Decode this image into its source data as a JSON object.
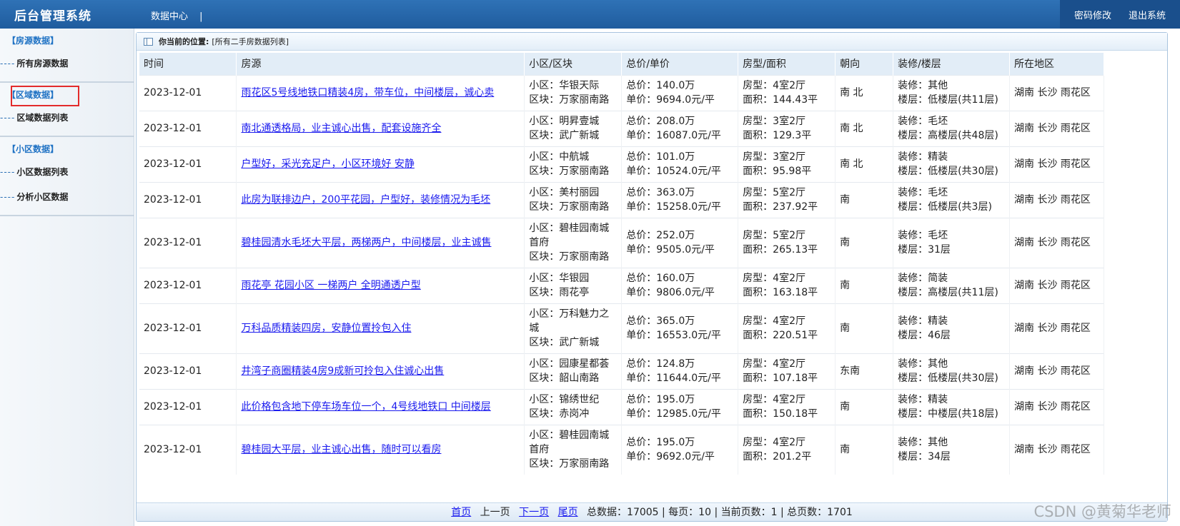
{
  "header": {
    "brand": "后台管理系统",
    "nav": [
      "数据中心",
      "|"
    ],
    "change_password": "密码修改",
    "logout": "退出系统"
  },
  "sidebar": {
    "sections": [
      {
        "title": "【房源数据】",
        "items": [
          {
            "dash": "----",
            "label": "所有房源数据"
          }
        ]
      },
      {
        "title": "【区域数据】",
        "items": [
          {
            "dash": "----",
            "label": "区域数据列表"
          }
        ]
      },
      {
        "title": "【小区数据】",
        "items": [
          {
            "dash": "----",
            "label": "小区数据列表"
          },
          {
            "dash": "----",
            "label": "分析小区数据"
          }
        ]
      }
    ]
  },
  "breadcrumb": {
    "label": "你当前的位置:",
    "value": "[所有二手房数据列表]"
  },
  "table": {
    "columns": [
      "时间",
      "房源",
      "小区/区块",
      "总价/单价",
      "房型/面积",
      "朝向",
      "装修/楼层",
      "所在地区"
    ],
    "rows": [
      {
        "time": "2023-12-01",
        "title": "雨花区5号线地铁口精装4房，带车位，中间楼层，诚心卖",
        "community": "小区：华银天际",
        "block": "区块：万家丽南路",
        "total": "总价：140.0万",
        "unit": "单价：9694.0元/平",
        "layout": "房型：4室2厅",
        "area": "面积：144.43平",
        "orient": "南 北",
        "decor": "装修：其他",
        "floor": "楼层：低楼层(共11层)",
        "region": "湖南 长沙 雨花区"
      },
      {
        "time": "2023-12-01",
        "title": "南北通透格局，业主诚心出售，配套设施齐全",
        "community": "小区：明昇壹城",
        "block": "区块：武广新城",
        "total": "总价：208.0万",
        "unit": "单价：16087.0元/平",
        "layout": "房型：3室2厅",
        "area": "面积：129.3平",
        "orient": "南 北",
        "decor": "装修：毛坯",
        "floor": "楼层：高楼层(共48层)",
        "region": "湖南 长沙 雨花区"
      },
      {
        "time": "2023-12-01",
        "title": "户型好，采光充足户，小区环境好 安静",
        "community": "小区：中航城",
        "block": "区块：万家丽南路",
        "total": "总价：101.0万",
        "unit": "单价：10524.0元/平",
        "layout": "房型：3室2厅",
        "area": "面积：95.98平",
        "orient": "南 北",
        "decor": "装修：精装",
        "floor": "楼层：低楼层(共30层)",
        "region": "湖南 长沙 雨花区"
      },
      {
        "time": "2023-12-01",
        "title": "此房为联排边户，200平花园，户型好，装修情况为毛坯",
        "community": "小区：美村丽园",
        "block": "区块：万家丽南路",
        "total": "总价：363.0万",
        "unit": "单价：15258.0元/平",
        "layout": "房型：5室2厅",
        "area": "面积：237.92平",
        "orient": "南",
        "decor": "装修：毛坯",
        "floor": "楼层：低楼层(共3层)",
        "region": "湖南 长沙 雨花区"
      },
      {
        "time": "2023-12-01",
        "title": "碧桂园清水毛坯大平层，两梯两户，中间楼层，业主诚售",
        "community": "小区：碧桂园南城首府",
        "block": "区块：万家丽南路",
        "total": "总价：252.0万",
        "unit": "单价：9505.0元/平",
        "layout": "房型：5室2厅",
        "area": "面积：265.13平",
        "orient": "南",
        "decor": "装修：毛坯",
        "floor": "楼层：31层",
        "region": "湖南 长沙 雨花区"
      },
      {
        "time": "2023-12-01",
        "title": "雨花亭 花园小区 一梯两户 全明通透户型",
        "community": "小区：华银园",
        "block": "区块：雨花亭",
        "total": "总价：160.0万",
        "unit": "单价：9806.0元/平",
        "layout": "房型：4室2厅",
        "area": "面积：163.18平",
        "orient": "南",
        "decor": "装修：简装",
        "floor": "楼层：高楼层(共11层)",
        "region": "湖南 长沙 雨花区"
      },
      {
        "time": "2023-12-01",
        "title": "万科品质精装四房，安静位置拎包入住",
        "community": "小区：万科魅力之城",
        "block": "区块：武广新城",
        "total": "总价：365.0万",
        "unit": "单价：16553.0元/平",
        "layout": "房型：4室2厅",
        "area": "面积：220.51平",
        "orient": "南",
        "decor": "装修：精装",
        "floor": "楼层：46层",
        "region": "湖南 长沙 雨花区"
      },
      {
        "time": "2023-12-01",
        "title": "井湾子商圈精装4房9成新可拎包入住诚心出售",
        "community": "小区：园康星都荟",
        "block": "区块：韶山南路",
        "total": "总价：124.8万",
        "unit": "单价：11644.0元/平",
        "layout": "房型：4室2厅",
        "area": "面积：107.18平",
        "orient": "东南",
        "decor": "装修：其他",
        "floor": "楼层：低楼层(共30层)",
        "region": "湖南 长沙 雨花区"
      },
      {
        "time": "2023-12-01",
        "title": "此价格包含地下停车场车位一个，4号线地铁口 中间楼层",
        "community": "小区：锦绣世纪",
        "block": "区块：赤岗冲",
        "total": "总价：195.0万",
        "unit": "单价：12985.0元/平",
        "layout": "房型：4室2厅",
        "area": "面积：150.18平",
        "orient": "南",
        "decor": "装修：精装",
        "floor": "楼层：中楼层(共18层)",
        "region": "湖南 长沙 雨花区"
      },
      {
        "time": "2023-12-01",
        "title": "碧桂园大平层，业主诚心出售，随时可以看房",
        "community": "小区：碧桂园南城首府",
        "block": "区块：万家丽南路",
        "total": "总价：195.0万",
        "unit": "单价：9692.0元/平",
        "layout": "房型：4室2厅",
        "area": "面积：201.2平",
        "orient": "南",
        "decor": "装修：其他",
        "floor": "楼层：34层",
        "region": "湖南 长沙 雨花区"
      }
    ]
  },
  "pager": {
    "first": "首页",
    "prev": "上一页",
    "next": "下一页",
    "last": "尾页",
    "summary": "总数据：17005 | 每页：10 | 当前页数：1 | 总页数：1701"
  },
  "watermark": "CSDN @黄菊华老师"
}
